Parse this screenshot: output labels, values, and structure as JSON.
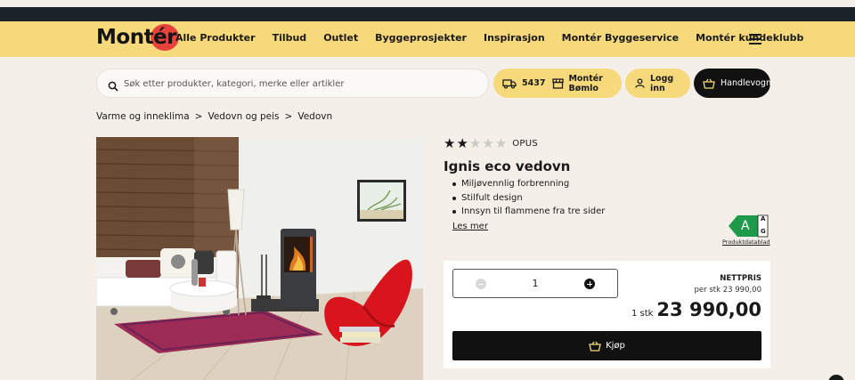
{
  "header": {
    "logo": {
      "prefix": "Mont",
      "accent_letter": "é",
      "suffix": "r",
      "brand_red": "#e8433a"
    },
    "nav": [
      {
        "label": "Alle Produkter"
      },
      {
        "label": "Tilbud"
      },
      {
        "label": "Outlet"
      },
      {
        "label": "Byggeprosjekter"
      },
      {
        "label": "Inspirasjon"
      },
      {
        "label": "Montér Byggeservice"
      },
      {
        "label": "Montér kundeklubb"
      }
    ],
    "menu_icon": "hamburger-icon",
    "nav_bg": "#f6d97a"
  },
  "search": {
    "placeholder": "Søk etter produkter, kategori, merke eller artikler",
    "icon": "search-icon"
  },
  "actions": {
    "postcode": "5437",
    "store": "Montér Bømlo",
    "login": "Logg inn",
    "cart": "Handlevogn"
  },
  "breadcrumb": [
    {
      "label": "Varme og inneklima"
    },
    {
      "sep": ">"
    },
    {
      "label": "Vedovn og peis"
    },
    {
      "sep": ">"
    },
    {
      "label": "Vedovn"
    }
  ],
  "product": {
    "rating": {
      "value": 2,
      "max": 5
    },
    "brand": "OPUS",
    "title": "Ignis eco vedovn",
    "features": [
      "Miljøvennlig forbrenning",
      "Stilfult design",
      "Innsyn til flammene fra tre sider"
    ],
    "read_more": "Les mer",
    "energy": {
      "class": "A",
      "scale_top": "A",
      "scale_bottom": "G",
      "link": "Produktdatablad",
      "color": "#1e9a4a"
    }
  },
  "buybox": {
    "quantity": "1",
    "price_label": "NETTPRIS",
    "per_unit": "per stk 23 990,00",
    "unit": "1 stk",
    "price": "23 990,00",
    "buy_label": "Kjøp"
  }
}
